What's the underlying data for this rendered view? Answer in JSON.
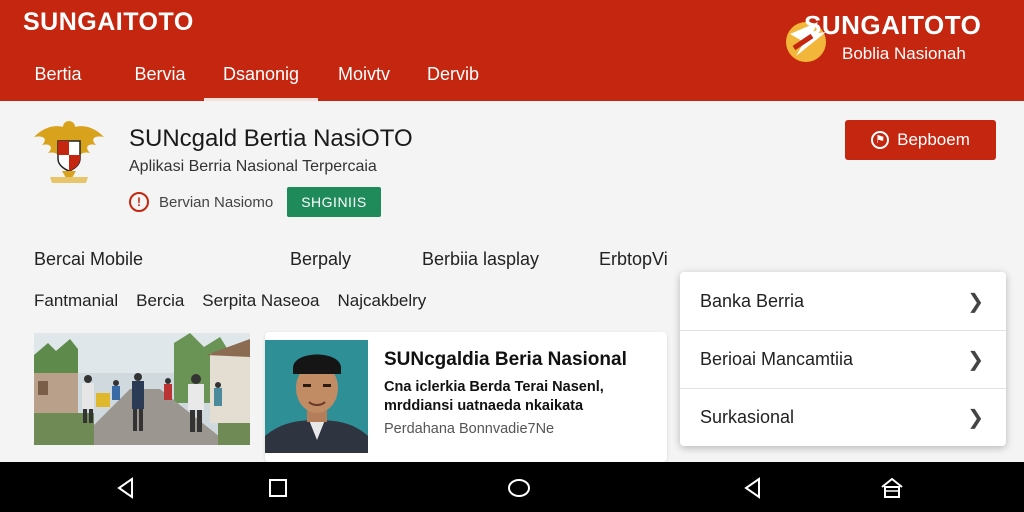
{
  "header": {
    "brand": "SUNGAITOTO",
    "logo_text": "SUNGAITOTO",
    "logo_subtitle": "Boblia Nasionah",
    "tabs": [
      {
        "label": "Bertia",
        "active": false
      },
      {
        "label": "Bervia",
        "active": false
      },
      {
        "label": "Dsanonig",
        "active": true
      },
      {
        "label": "Moivtv",
        "active": false
      },
      {
        "label": "Dervib",
        "active": false
      }
    ]
  },
  "app": {
    "title": "SUNcgald Bertia NasiOTO",
    "subtitle": "Aplikasi Berria Nasional Terpercaia",
    "source_label": "Bervian Nasiomo",
    "tag": "SHGINIIS",
    "cta_label": "Bepboem"
  },
  "categories_row1": [
    "Bercai Mobile",
    "Berpaly",
    "Berbiia lasplay",
    "ErbtopVi"
  ],
  "categories_row2": [
    "Fantmanial",
    "Bercia",
    "Serpita Naseoa",
    "Najcakbelry"
  ],
  "card": {
    "title": "SUNcgaldia Beria Nasional",
    "line1": "Cna iclerkia Berda Terai Nasenl,",
    "line2": "mrddiansi uatnaeda nkaikata",
    "meta": "Perdahana Bonnvadie7Ne"
  },
  "dropdown": {
    "items": [
      "Banka Berria",
      "Berioai Mancamtiia",
      "Surkasional"
    ]
  },
  "colors": {
    "brand_red": "#c4260f",
    "tag_green": "#1f8a5a",
    "logo_gold": "#f2b63a"
  },
  "icons": {
    "source": "alert-circle-icon",
    "cta": "flag-circle-icon",
    "chevron": "chevron-right-icon",
    "nav_back": "back-triangle-icon",
    "nav_recents": "square-icon",
    "nav_home": "circle-icon",
    "nav_home2": "house-icon"
  }
}
